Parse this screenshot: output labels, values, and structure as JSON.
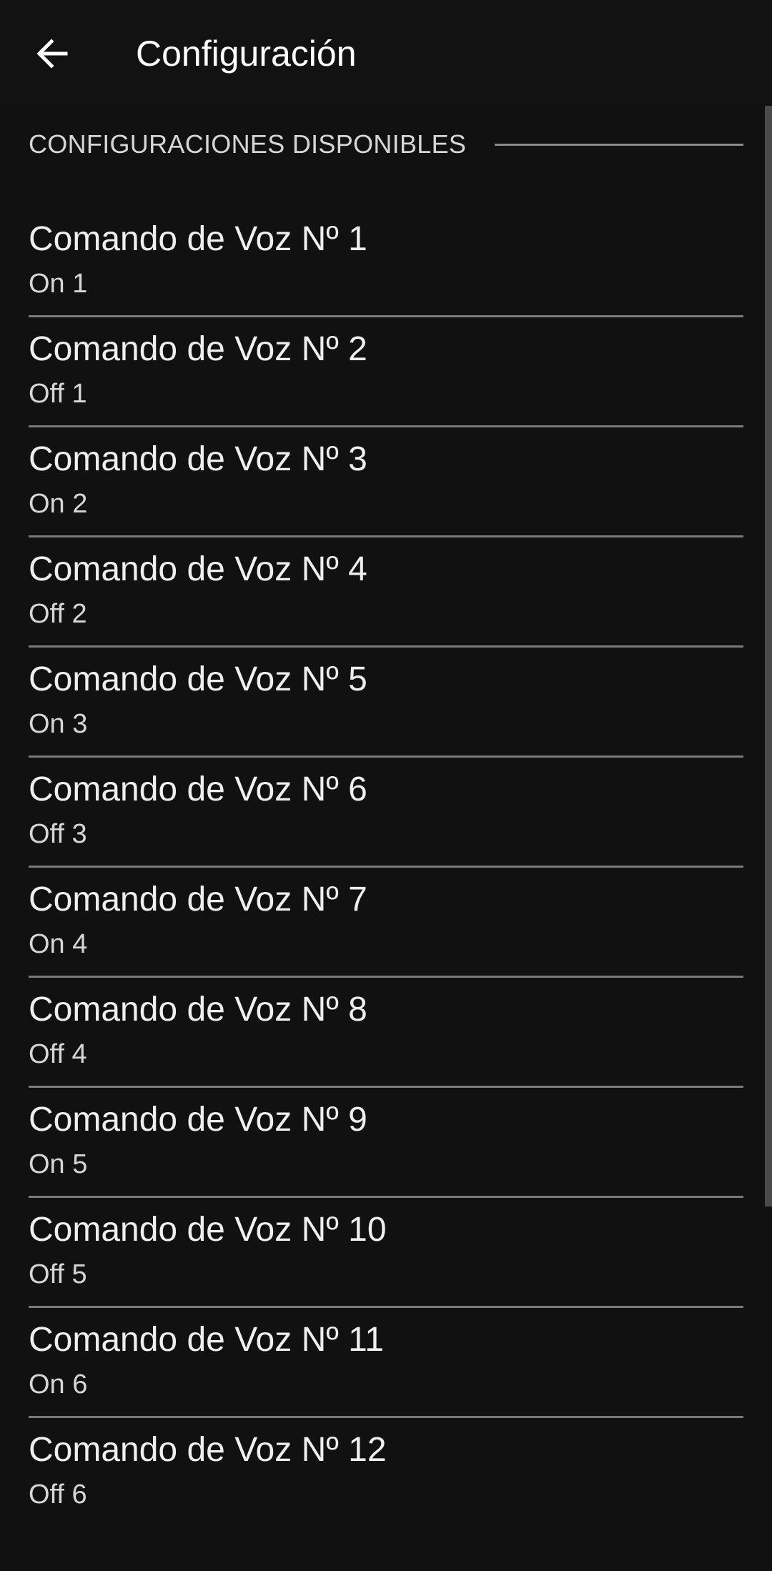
{
  "toolbar": {
    "title": "Configuración",
    "back_icon": "arrow-left-icon"
  },
  "section": {
    "title": "CONFIGURACIONES DISPONIBLES"
  },
  "commands": [
    {
      "title": "Comando de Voz Nº 1",
      "summary": "On 1"
    },
    {
      "title": "Comando de Voz Nº 2",
      "summary": "Off 1"
    },
    {
      "title": "Comando de Voz Nº 3",
      "summary": "On 2"
    },
    {
      "title": "Comando de Voz Nº 4",
      "summary": "Off 2"
    },
    {
      "title": "Comando de Voz Nº 5",
      "summary": "On 3"
    },
    {
      "title": "Comando de Voz Nº 6",
      "summary": "Off 3"
    },
    {
      "title": "Comando de Voz Nº 7",
      "summary": "On 4"
    },
    {
      "title": "Comando de Voz Nº 8",
      "summary": "Off 4"
    },
    {
      "title": "Comando de Voz Nº 9",
      "summary": "On 5"
    },
    {
      "title": "Comando de Voz Nº 10",
      "summary": "Off 5"
    },
    {
      "title": "Comando de Voz Nº 11",
      "summary": "On 6"
    },
    {
      "title": "Comando de Voz Nº 12",
      "summary": "Off 6"
    }
  ],
  "colors": {
    "background": "#111111",
    "text_primary": "#efefef",
    "text_secondary": "#d6d6d6",
    "divider": "#7a7a7a"
  }
}
